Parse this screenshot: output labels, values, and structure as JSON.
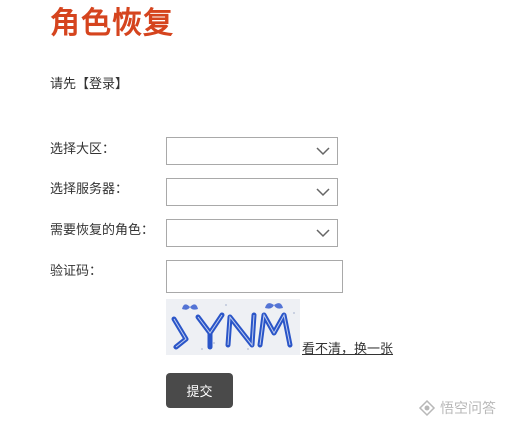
{
  "page": {
    "title": "角色恢复"
  },
  "login_prompt": {
    "prefix": "请先",
    "link_label": "【登录】"
  },
  "form": {
    "region_label": "选择大区：",
    "region_value": "",
    "server_label": "选择服务器：",
    "server_value": "",
    "role_label": "需要恢复的角色：",
    "role_value": "",
    "captcha_label": "验证码：",
    "captcha_value": "",
    "captcha_text": "YNM",
    "refresh_label": "看不清，换一张",
    "submit_label": "提交"
  },
  "watermark": {
    "text": "悟空问答",
    "icon": "logo-icon"
  },
  "colors": {
    "title": "#d5441e",
    "button": "#4a4a4a",
    "captcha_letters": "#2a55c8"
  }
}
